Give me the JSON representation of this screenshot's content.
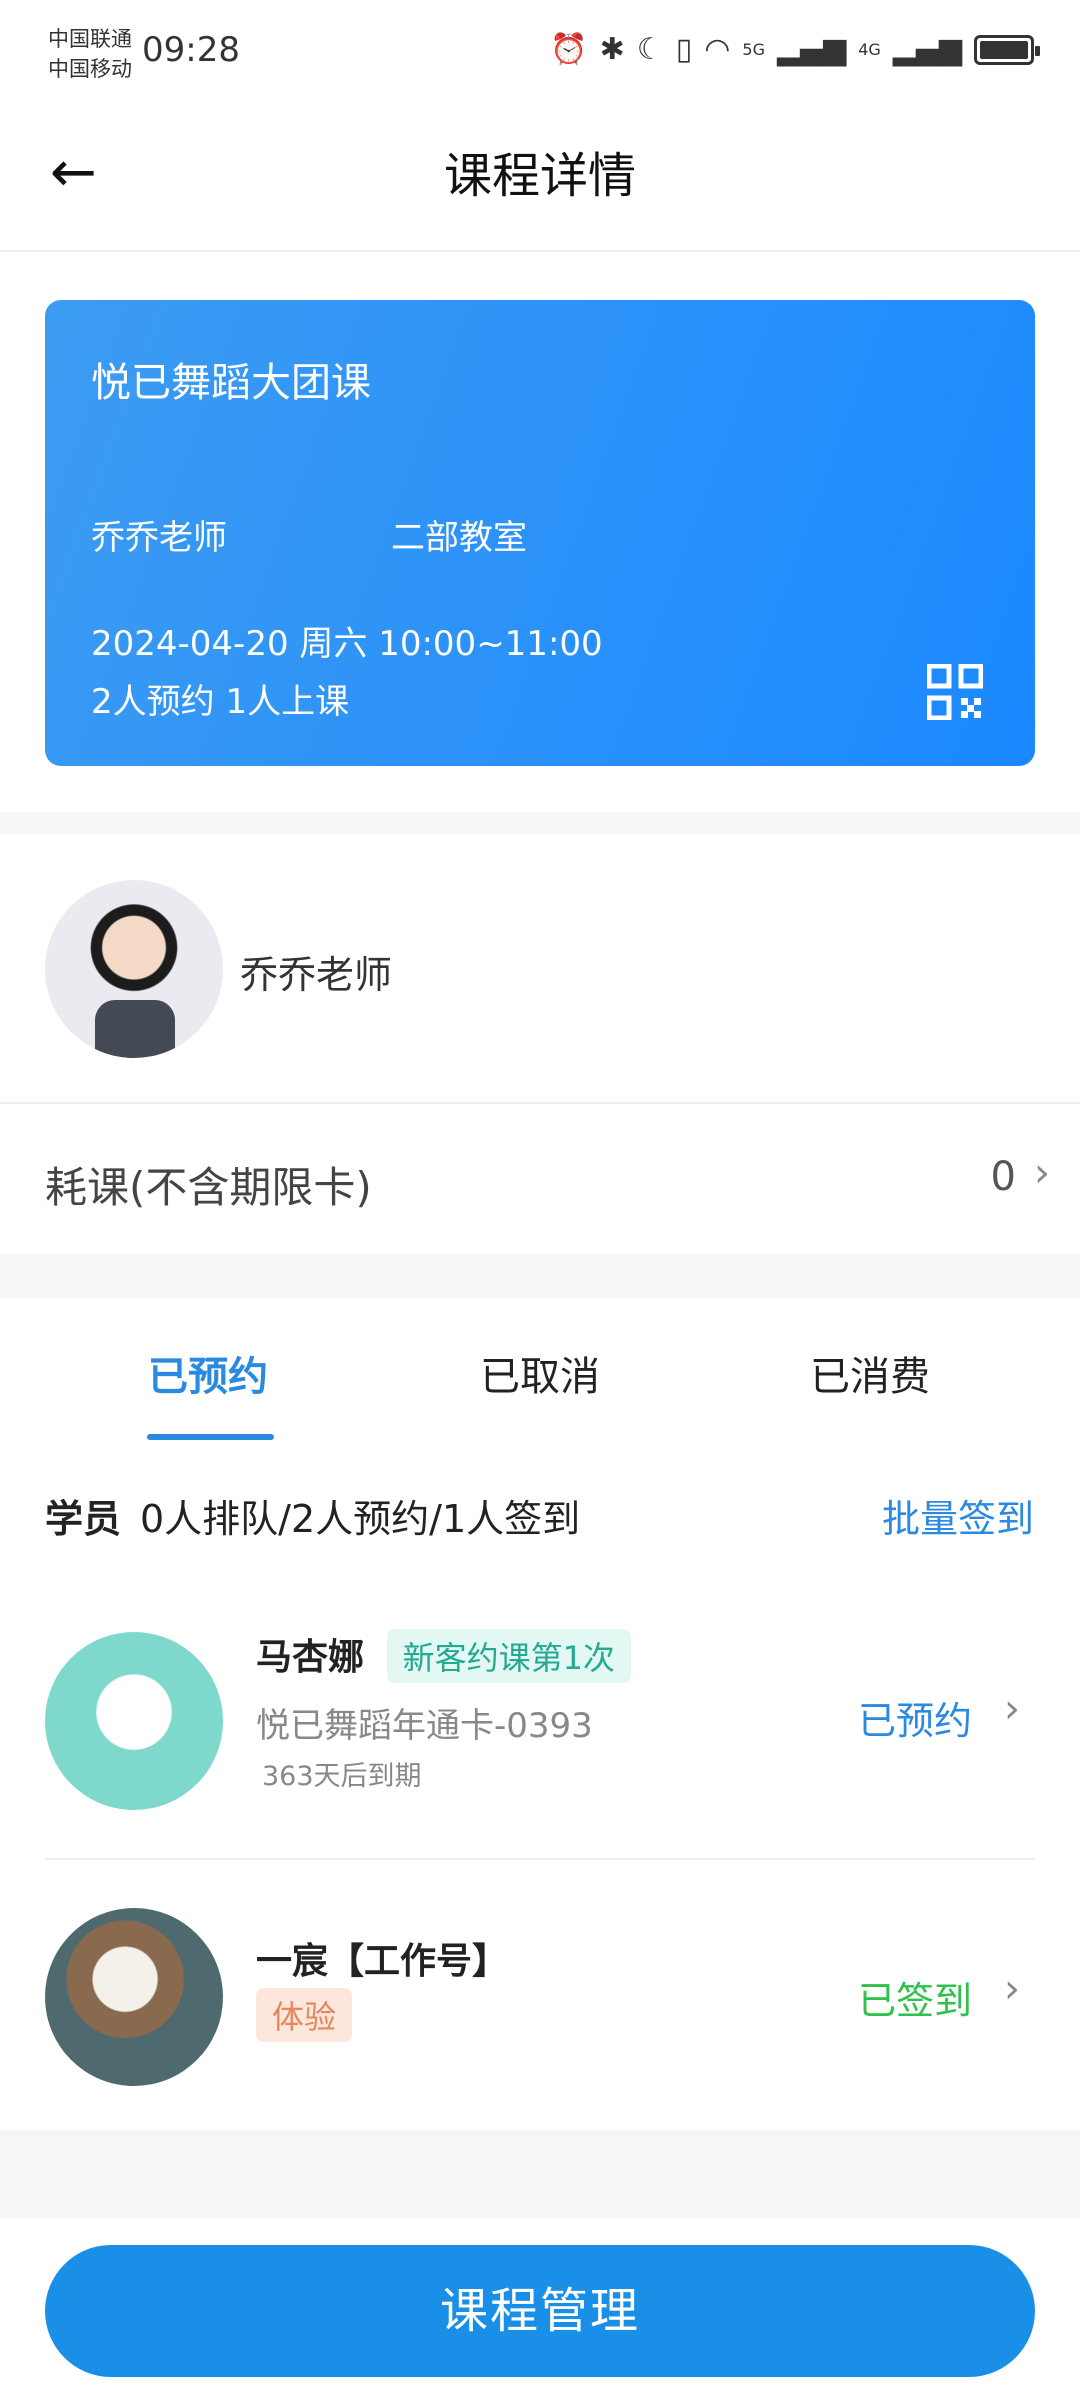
{
  "status_bar": {
    "carrier1": "中国联通",
    "carrier2": "中国移动",
    "time": "09:28",
    "signal1": "5G",
    "signal2": "4G"
  },
  "header": {
    "title": "课程详情"
  },
  "course_card": {
    "name": "悦已舞蹈大团课",
    "teacher": "乔乔老师",
    "room": "二部教室",
    "datetime": "2024-04-20 周六 10:00~11:00",
    "booking_count": "2人预约 1人上课",
    "qr_icon": "qr-code-icon"
  },
  "teacher": {
    "name": "乔乔老师"
  },
  "consume": {
    "label": "耗课(不含期限卡)",
    "value": "0"
  },
  "tabs": [
    {
      "label": "已预约"
    },
    {
      "label": "已取消"
    },
    {
      "label": "已消费"
    }
  ],
  "students_header": {
    "label": "学员",
    "summary": "0人排队/2人预约/1人签到",
    "batch_label": "批量签到"
  },
  "students": [
    {
      "name": "马杏娜",
      "tag": "新客约课第1次",
      "card": "悦已舞蹈年通卡-0393",
      "expiry": "363天后到期",
      "status": "已预约",
      "status_color": "#2a8ae0"
    },
    {
      "name": "一宸【工作号】",
      "tag": "体验",
      "status": "已签到",
      "status_color": "#2ec24a"
    }
  ],
  "footer": {
    "manage_label": "课程管理"
  },
  "colors": {
    "accent": "#1a8fe8",
    "tag_new_bg": "#e3f7f3",
    "tag_new_fg": "#24a992",
    "tag_trial_bg": "#fde7dc",
    "tag_trial_fg": "#e7865a"
  }
}
